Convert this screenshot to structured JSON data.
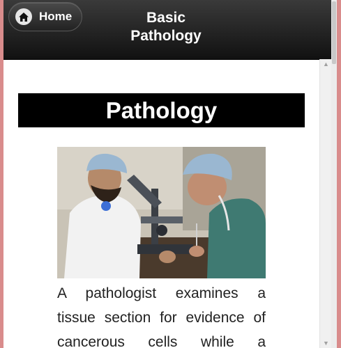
{
  "header": {
    "home_label": "Home",
    "title_line1": "Basic",
    "title_line2": "Pathology"
  },
  "main": {
    "page_title": "Pathology",
    "caption_lines": [
      "A pathologist examines a",
      "tissue section for evidence of",
      "cancerous cells while a"
    ]
  },
  "icons": {
    "home": "home-icon",
    "scroll_up": "up-arrow-icon",
    "scroll_down": "down-arrow-icon"
  },
  "colors": {
    "header_bg": "#1a1a1a",
    "title_band": "#000000",
    "frame_border": "#d98c8c"
  }
}
